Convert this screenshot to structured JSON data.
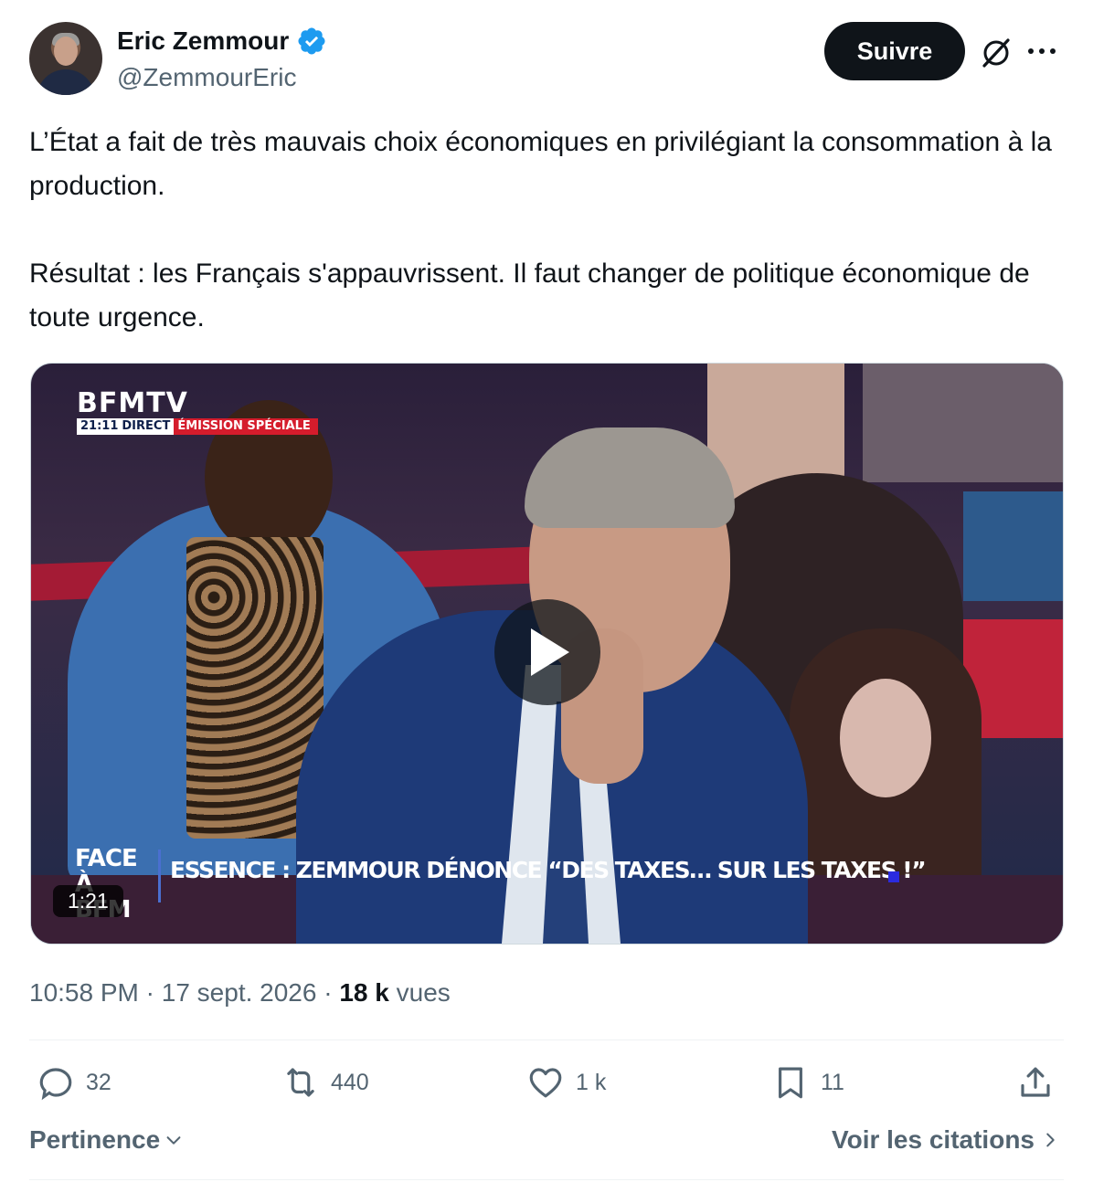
{
  "author": {
    "name": "Eric Zemmour",
    "handle": "@ZemmourEric",
    "verified_icon": "verified-badge-icon",
    "verified_color": "#1d9bf0"
  },
  "header": {
    "follow_label": "Suivre",
    "grok_icon": "grok-slash-icon",
    "more_icon": "more-horizontal-icon"
  },
  "tweet": {
    "paragraphs": [
      "L’État a fait de très mauvais choix économiques en privilégiant la consommation à la production.",
      "Résultat : les Français s'appauvrissent. Il faut changer de politique économique de toute urgence."
    ]
  },
  "video": {
    "channel_logo": "BFMTV",
    "clock": "21:11",
    "live_label": "DIRECT",
    "program_label": "ÉMISSION SPÉCIALE",
    "show_name": "FACE À BFM",
    "banner_text": "ESSENCE : ZEMMOUR DÉNONCE “DES TAXES… SUR LES TAXES !”",
    "duration": "1:21",
    "play_icon": "play-icon"
  },
  "meta": {
    "time": "10:58 PM",
    "separator": "·",
    "date": "17 sept. 2026",
    "views_count": "18 k",
    "views_label": "vues"
  },
  "actions": {
    "replies": "32",
    "reposts": "440",
    "likes": "1 k",
    "bookmarks": "11",
    "share_icon": "share-icon"
  },
  "footer": {
    "sort_label": "Pertinence",
    "quotes_label": "Voir les citations"
  },
  "colors": {
    "text_primary": "#0f1419",
    "text_secondary": "#536471",
    "border": "#eff3f4",
    "button_bg": "#0f1419"
  }
}
